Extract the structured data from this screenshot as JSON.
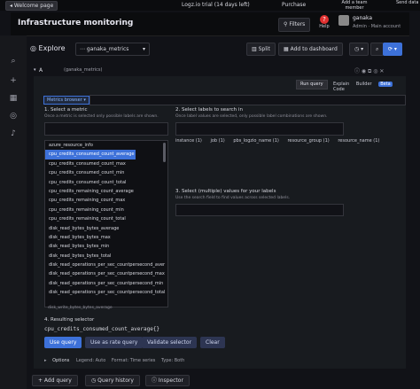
{
  "topbar": {
    "welcome": "◂ Welcome page",
    "trial": "Logz.io trial  (14 days left)",
    "purchase": "Purchase",
    "add_member": "Add a team member",
    "send_data": "Send data"
  },
  "header": {
    "title": "Infrastructure monitoring",
    "filters": "Filters",
    "help": "Help",
    "user_name": "ganaka",
    "user_role": "Admin  ·  Main account"
  },
  "explore": {
    "label": "Explore",
    "datasource": "ganaka_metrics",
    "split": "Split",
    "add_dashboard": "Add to dashboard"
  },
  "query": {
    "letter": "A",
    "datasource": "(ganaka_metrics)",
    "run_query": "Run query",
    "modes": [
      "Explain",
      "Builder",
      "Code"
    ],
    "beta": "Beta",
    "metrics_browser": "Metrics browser ▾"
  },
  "step1": {
    "title": "1. Select a metric",
    "subtitle": "Once a metric is selected only possible labels are shown."
  },
  "step2": {
    "title": "2. Select labels to search in",
    "subtitle": "Once label values are selected, only possible label combinations are shown.",
    "chips": [
      "instance (1)",
      "job (1)",
      "pbs_logzio_name (1)",
      "resource_group (1)",
      "resource_name (1)"
    ]
  },
  "step3": {
    "title": "3. Select (multiple) values for your labels",
    "subtitle": "Use the search field to find values across selected labels."
  },
  "metrics": [
    "azure_resource_info",
    "cpu_credits_consumed_count_average",
    "cpu_credits_consumed_count_max",
    "cpu_credits_consumed_count_min",
    "cpu_credits_consumed_count_total",
    "cpu_credits_remaining_count_average",
    "cpu_credits_remaining_count_max",
    "cpu_credits_remaining_count_min",
    "cpu_credits_remaining_count_total",
    "disk_read_bytes_bytes_average",
    "disk_read_bytes_bytes_max",
    "disk_read_bytes_bytes_min",
    "disk_read_bytes_bytes_total",
    "disk_read_operations_per_sec_countpersecond_aver",
    "disk_read_operations_per_sec_countpersecond_max",
    "disk_read_operations_per_sec_countpersecond_min",
    "disk_read_operations_per_sec_countpersecond_total"
  ],
  "metric_partial": "disk_write_bytes_bytes_average",
  "selected_metric_index": 1,
  "step4": {
    "title": "4. Resulting selector",
    "value": "cpu_credits_consumed_count_average{}"
  },
  "actions": {
    "use_query": "Use query",
    "rate_query": "Use as rate query",
    "validate": "Validate selector",
    "clear": "Clear"
  },
  "options": {
    "label": "Options",
    "items": [
      "Legend: Auto",
      "Format: Time series",
      "Type: Both"
    ]
  },
  "bottom": {
    "add_query": "+ Add query",
    "history": "Query history",
    "inspector": "Inspector"
  }
}
